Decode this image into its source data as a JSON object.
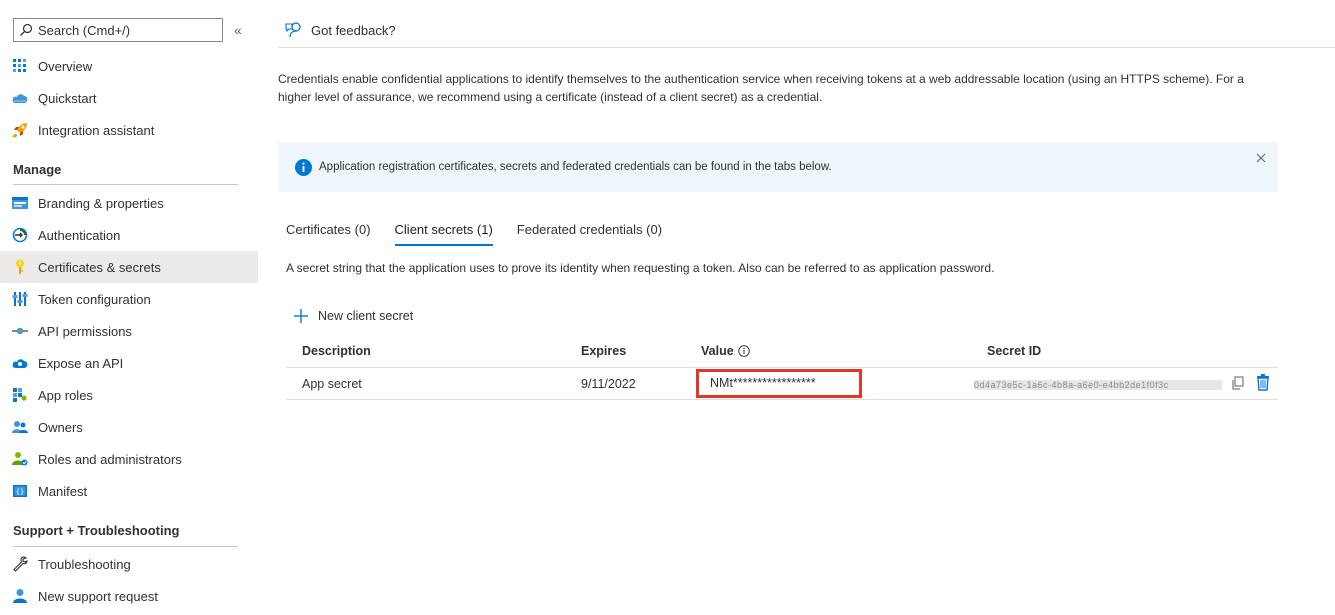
{
  "search": {
    "placeholder": "Search (Cmd+/)"
  },
  "sidebar": {
    "top_items": [
      {
        "label": "Overview",
        "icon": "overview-icon"
      },
      {
        "label": "Quickstart",
        "icon": "cloud-icon"
      },
      {
        "label": "Integration assistant",
        "icon": "rocket-icon"
      }
    ],
    "manage_header": "Manage",
    "manage_items": [
      {
        "label": "Branding & properties",
        "icon": "branding-icon"
      },
      {
        "label": "Authentication",
        "icon": "authentication-icon"
      },
      {
        "label": "Certificates & secrets",
        "icon": "key-icon",
        "active": true
      },
      {
        "label": "Token configuration",
        "icon": "token-icon"
      },
      {
        "label": "API permissions",
        "icon": "api-permissions-icon"
      },
      {
        "label": "Expose an API",
        "icon": "cloud-api-icon"
      },
      {
        "label": "App roles",
        "icon": "app-roles-icon"
      },
      {
        "label": "Owners",
        "icon": "owners-icon"
      },
      {
        "label": "Roles and administrators",
        "icon": "roles-icon"
      },
      {
        "label": "Manifest",
        "icon": "manifest-icon"
      }
    ],
    "support_header": "Support + Troubleshooting",
    "support_items": [
      {
        "label": "Troubleshooting",
        "icon": "wrench-icon"
      },
      {
        "label": "New support request",
        "icon": "support-person-icon"
      }
    ]
  },
  "commandbar": {
    "feedback_label": "Got feedback?"
  },
  "main": {
    "description": "Credentials enable confidential applications to identify themselves to the authentication service when receiving tokens at a web addressable location (using an HTTPS scheme). For a higher level of assurance, we recommend using a certificate (instead of a client secret) as a credential.",
    "info_message": "Application registration certificates, secrets and federated credentials can be found in the tabs below.",
    "tabs": [
      {
        "label": "Certificates (0)"
      },
      {
        "label": "Client secrets (1)",
        "active": true
      },
      {
        "label": "Federated credentials (0)"
      }
    ],
    "tab_description": "A secret string that the application uses to prove its identity when requesting a token. Also can be referred to as application password.",
    "new_secret_label": "New client secret",
    "table": {
      "headers": [
        "Description",
        "Expires",
        "Value",
        "Secret ID"
      ],
      "rows": [
        {
          "description": "App secret",
          "expires": "9/11/2022",
          "value": "NMt*****************",
          "secret_id": "0d4a73e5c-1a6c-4b8a-a6e0-e4bb2de1f0f3c"
        }
      ]
    }
  },
  "colors": {
    "accent": "#0078d4",
    "highlight_border": "#e3352a",
    "info_bg": "#eff6fc",
    "active_nav_bg": "#edebe9"
  }
}
